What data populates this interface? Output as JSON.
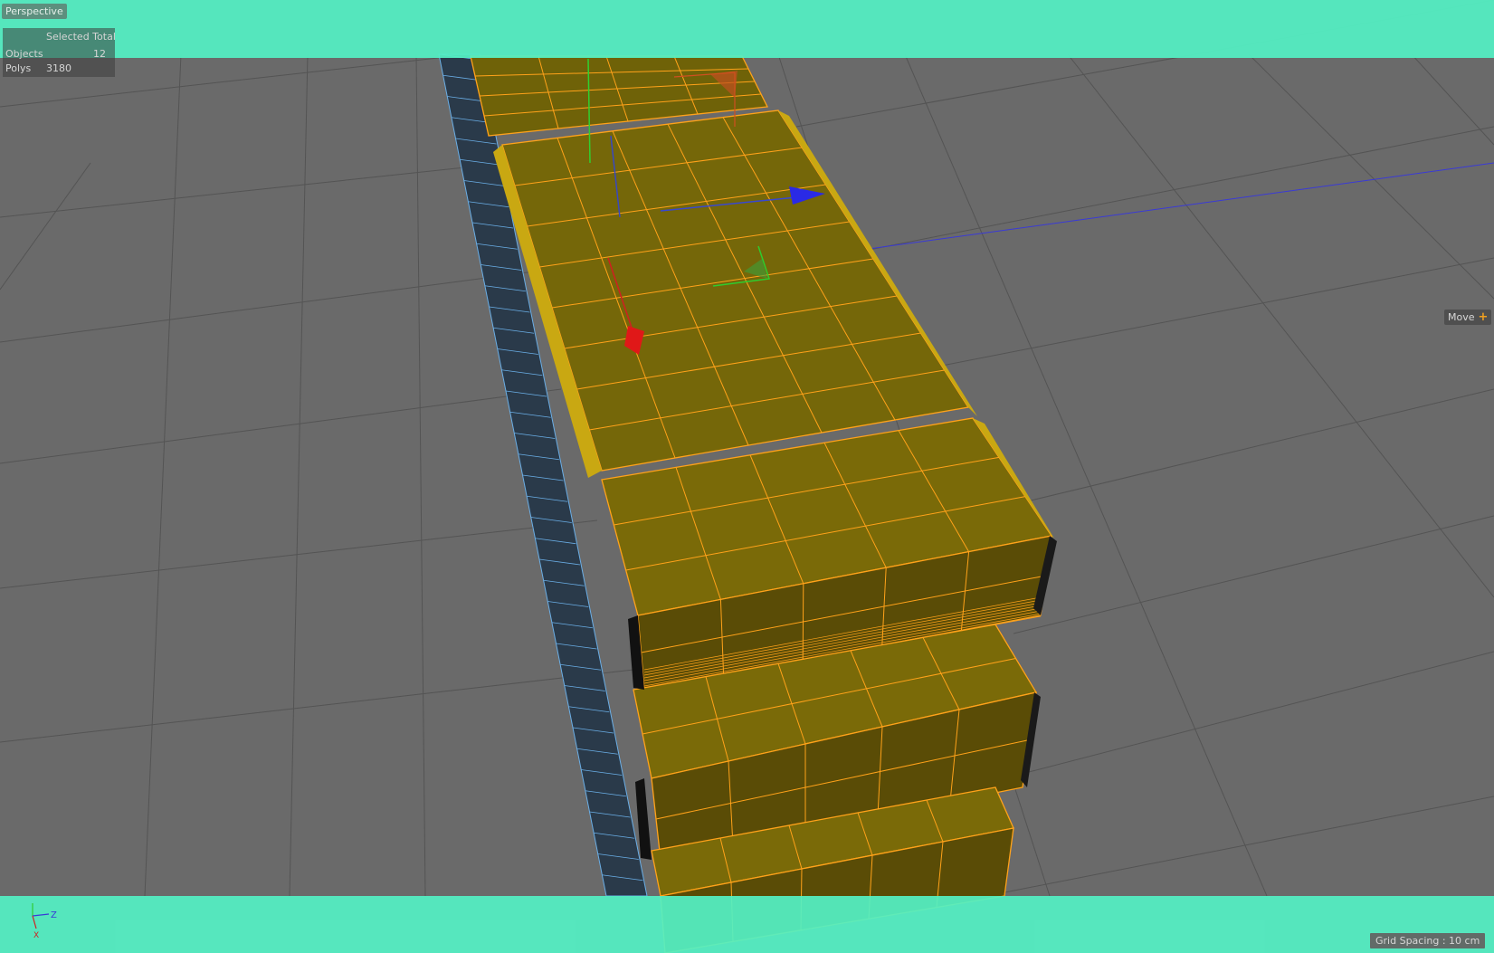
{
  "viewport": {
    "camera_label": "Perspective",
    "hud": {
      "header": "Selected Total",
      "rows": [
        {
          "label": "Objects",
          "value": "12"
        },
        {
          "label": "Polys",
          "value": "3180"
        }
      ]
    },
    "active_tool": "Move",
    "grid_spacing": "Grid Spacing : 10 cm",
    "axis_labels": {
      "z": "Z",
      "x": "X"
    }
  },
  "colors": {
    "background": "#6a6a6a",
    "grid_line": "#545454",
    "object_fill": "#7a6a08",
    "wire": "#ffa21a",
    "blue_wire": "#6aaee6",
    "safe_frame": "#54f0c4",
    "axis_x": "#e02020",
    "axis_y": "#2ecc2e",
    "axis_z": "#2a2ae6"
  },
  "icons": [
    "move-tool-icon",
    "world-axis-icon",
    "move-gizmo-icon"
  ]
}
